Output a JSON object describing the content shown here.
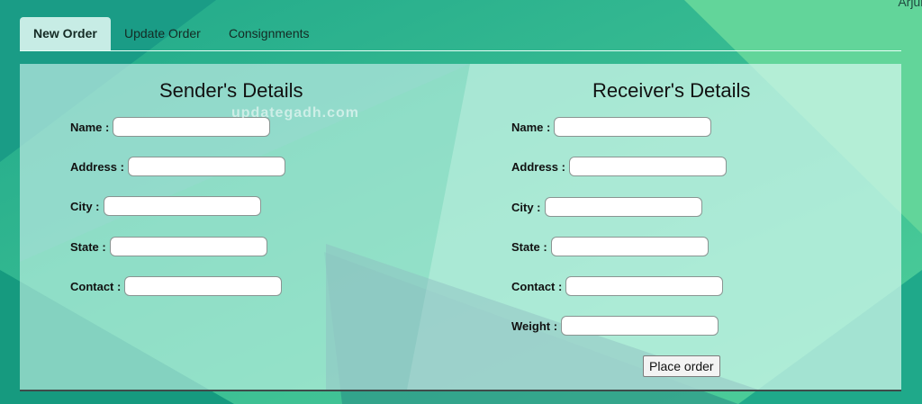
{
  "user": {
    "name": "Arjun"
  },
  "tabs": [
    {
      "label": "New Order",
      "active": true
    },
    {
      "label": "Update Order",
      "active": false
    },
    {
      "label": "Consignments",
      "active": false
    }
  ],
  "sender": {
    "title": "Sender's Details",
    "fields": [
      {
        "label": "Name :",
        "value": ""
      },
      {
        "label": "Address :",
        "value": ""
      },
      {
        "label": "City :",
        "value": ""
      },
      {
        "label": "State :",
        "value": ""
      },
      {
        "label": "Contact :",
        "value": ""
      }
    ]
  },
  "receiver": {
    "title": "Receiver's Details",
    "fields": [
      {
        "label": "Name :",
        "value": ""
      },
      {
        "label": "Address :",
        "value": ""
      },
      {
        "label": "City :",
        "value": ""
      },
      {
        "label": "State :",
        "value": ""
      },
      {
        "label": "Contact :",
        "value": ""
      },
      {
        "label": "Weight :",
        "value": ""
      }
    ]
  },
  "place_order_label": "Place order",
  "watermark": "updategadh.com",
  "colors": {
    "background": "#2fb893",
    "panel": "#c8f5e8",
    "tab_active": "#c7ece5"
  }
}
